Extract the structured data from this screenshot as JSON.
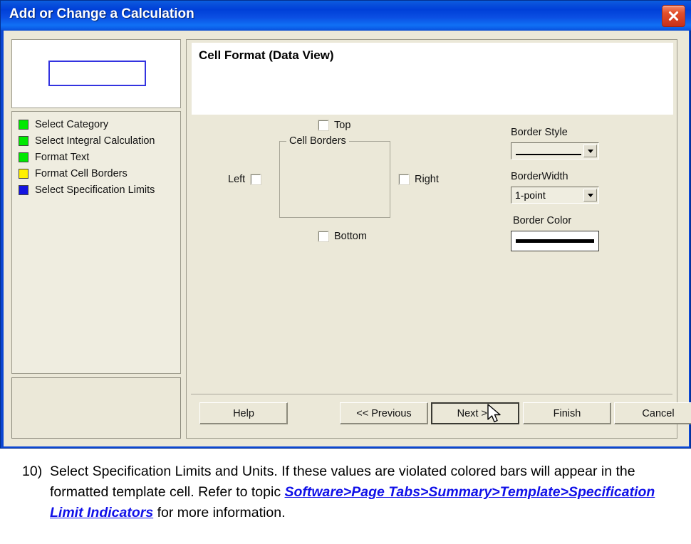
{
  "window": {
    "title": "Add or Change a Calculation",
    "close_icon": "close-icon"
  },
  "sidebar": {
    "steps": [
      {
        "label": "Select Category",
        "color": "#00E800"
      },
      {
        "label": "Select Integral Calculation",
        "color": "#00E800"
      },
      {
        "label": "Format Text",
        "color": "#00E800"
      },
      {
        "label": "Format Cell Borders",
        "color": "#FFF000"
      },
      {
        "label": "Select Specification Limits",
        "color": "#1414E0"
      }
    ]
  },
  "main": {
    "panel_title": "Cell Format (Data View)",
    "cell_borders_group": "Cell Borders",
    "checkboxes": [
      {
        "name": "top",
        "label": "Top",
        "checked": false
      },
      {
        "name": "left",
        "label": "Left",
        "checked": false
      },
      {
        "name": "right",
        "label": "Right",
        "checked": false
      },
      {
        "name": "bottom",
        "label": "Bottom",
        "checked": false
      }
    ],
    "border_style": {
      "label": "Border Style",
      "value": "",
      "sample": "solid-line"
    },
    "border_width": {
      "label": "BorderWidth",
      "value": "1-point"
    },
    "border_color": {
      "label": "Border Color",
      "value": "#000000"
    }
  },
  "buttons": {
    "help": "Help",
    "previous": "<< Previous",
    "next": "Next >>",
    "finish": "Finish",
    "cancel": "Cancel"
  },
  "caption": {
    "number": "10)",
    "text_before": "Select Specification Limits and Units. If these values are violated colored bars will appear in the formatted template cell. Refer to   topic ",
    "link": "Software>Page Tabs>Summary>Template>Specification Limit Indicators",
    "text_after": " for more information."
  },
  "colors": {
    "titlebar_blue": "#0a46d2",
    "dialog_beige": "#EBE8D8",
    "link_blue": "#1010E8"
  }
}
